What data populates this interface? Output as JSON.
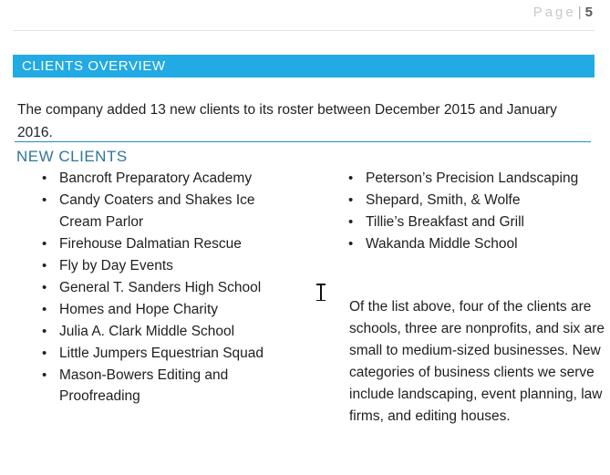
{
  "header": {
    "page_label": "Page",
    "separator": "|",
    "page_number": "5"
  },
  "section": {
    "banner_title": "CLIENTS OVERVIEW",
    "banner_color": "#22aae4",
    "intro": "The company added 13 new clients to its roster between December 2015 and January 2016."
  },
  "subsection": {
    "title": "NEW CLIENTS",
    "title_color": "#31749b",
    "rule_color": "#1e8fc9"
  },
  "clients": {
    "bullet_glyph": "•",
    "left_column": [
      "Bancroft Preparatory Academy",
      "Candy Coaters and Shakes Ice Cream Parlor",
      "Firehouse Dalmatian Rescue",
      "Fly by Day Events",
      "General T. Sanders High School",
      "Homes and Hope Charity",
      "Julia A. Clark Middle School",
      "Little Jumpers Equestrian Squad",
      "Mason-Bowers Editing and Proofreading"
    ],
    "right_column": [
      "Peterson’s Precision Landscaping",
      "Shepard, Smith, & Wolfe",
      "Tillie’s Breakfast and Grill",
      "Wakanda Middle School"
    ]
  },
  "note": {
    "text": "Of the list above, four of the clients are schools, three are nonprofits, and six are small to medium-sized businesses. New categories of business clients we serve include landscaping, event planning, law firms, and editing houses."
  },
  "cursor": {
    "kind": "i-beam-text-cursor"
  }
}
